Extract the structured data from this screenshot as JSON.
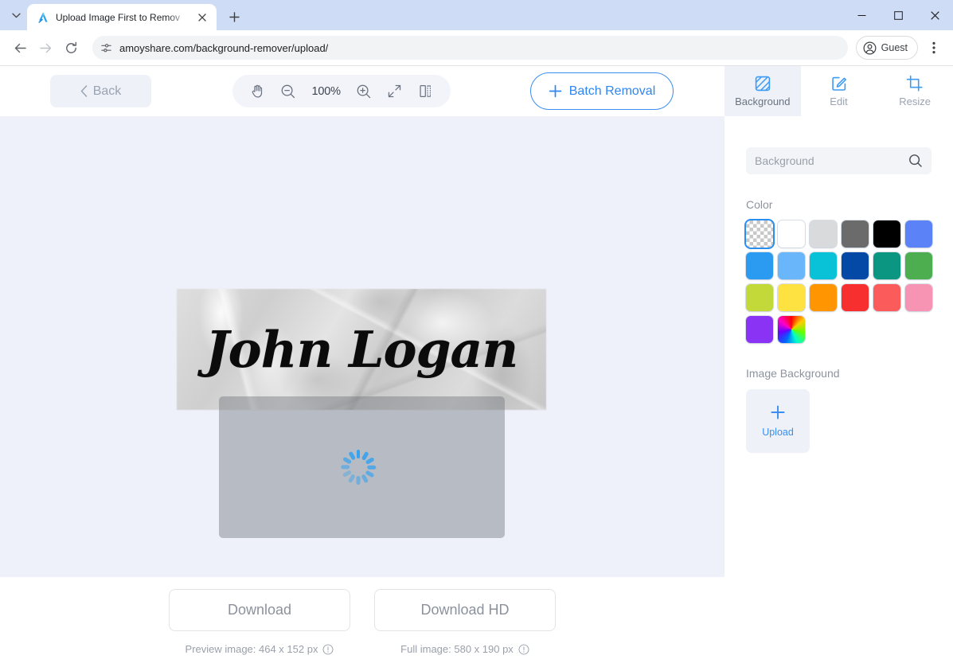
{
  "browser": {
    "tab": {
      "title": "Upload Image First to Remov",
      "favicon_name": "amoyshare-logo-icon",
      "close_label": "×"
    },
    "new_tab_label": "+",
    "address": "amoyshare.com/background-remover/upload/",
    "profile_label": "Guest",
    "window_controls": {
      "minimize": "−",
      "maximize": "□",
      "close": "✕"
    }
  },
  "app": {
    "back_label": "Back",
    "zoom": {
      "level": "100%",
      "tools": [
        "hand-tool-icon",
        "zoom-out-icon",
        "zoom-in-icon",
        "fit-screen-icon",
        "compare-icon"
      ]
    },
    "batch_button": {
      "label": "Batch Removal",
      "plus": "+",
      "accent": "#2f86f0"
    },
    "mode_tabs": [
      {
        "label": "Background",
        "icon": "background-stripe-icon",
        "active": true
      },
      {
        "label": "Edit",
        "icon": "edit-pencil-icon",
        "active": false
      },
      {
        "label": "Resize",
        "icon": "crop-resize-icon",
        "active": false
      }
    ]
  },
  "canvas": {
    "background_color": "#eef1fa",
    "image_text": "John Logan",
    "status": "processing"
  },
  "download": {
    "preview": {
      "button_label": "Download",
      "caption": "Preview image: 464 x 152 px",
      "info_icon": "info-circle-icon"
    },
    "full": {
      "button_label": "Download HD",
      "caption": "Full image: 580 x 190 px",
      "info_icon": "info-circle-icon"
    }
  },
  "panel": {
    "search": {
      "placeholder": "Background",
      "value": "",
      "icon": "search-icon"
    },
    "color_section_label": "Color",
    "colors": [
      {
        "name": "transparent",
        "hex": "transparent",
        "selected": true
      },
      {
        "name": "white",
        "hex": "#ffffff",
        "selected": false
      },
      {
        "name": "light-gray",
        "hex": "#d9dadc",
        "selected": false
      },
      {
        "name": "dark-gray",
        "hex": "#6b6b6b",
        "selected": false
      },
      {
        "name": "black",
        "hex": "#000000",
        "selected": false
      },
      {
        "name": "royal-blue",
        "hex": "#5b82f7",
        "selected": false
      },
      {
        "name": "azure",
        "hex": "#2a9bf0",
        "selected": false
      },
      {
        "name": "sky-blue",
        "hex": "#69b6fb",
        "selected": false
      },
      {
        "name": "cyan",
        "hex": "#09c2d8",
        "selected": false
      },
      {
        "name": "navy",
        "hex": "#0449a5",
        "selected": false
      },
      {
        "name": "teal",
        "hex": "#0a9680",
        "selected": false
      },
      {
        "name": "green",
        "hex": "#4cae4f",
        "selected": false
      },
      {
        "name": "lime",
        "hex": "#c3d93a",
        "selected": false
      },
      {
        "name": "yellow",
        "hex": "#fde241",
        "selected": false
      },
      {
        "name": "orange",
        "hex": "#ff9500",
        "selected": false
      },
      {
        "name": "red",
        "hex": "#f82f2f",
        "selected": false
      },
      {
        "name": "coral",
        "hex": "#fb5b5b",
        "selected": false
      },
      {
        "name": "pink",
        "hex": "#f794b4",
        "selected": false
      },
      {
        "name": "purple",
        "hex": "#8a33f5",
        "selected": false
      },
      {
        "name": "rainbow",
        "hex": "rainbow",
        "selected": false
      }
    ],
    "image_section_label": "Image Background",
    "upload": {
      "label": "Upload",
      "plus": "+"
    }
  }
}
